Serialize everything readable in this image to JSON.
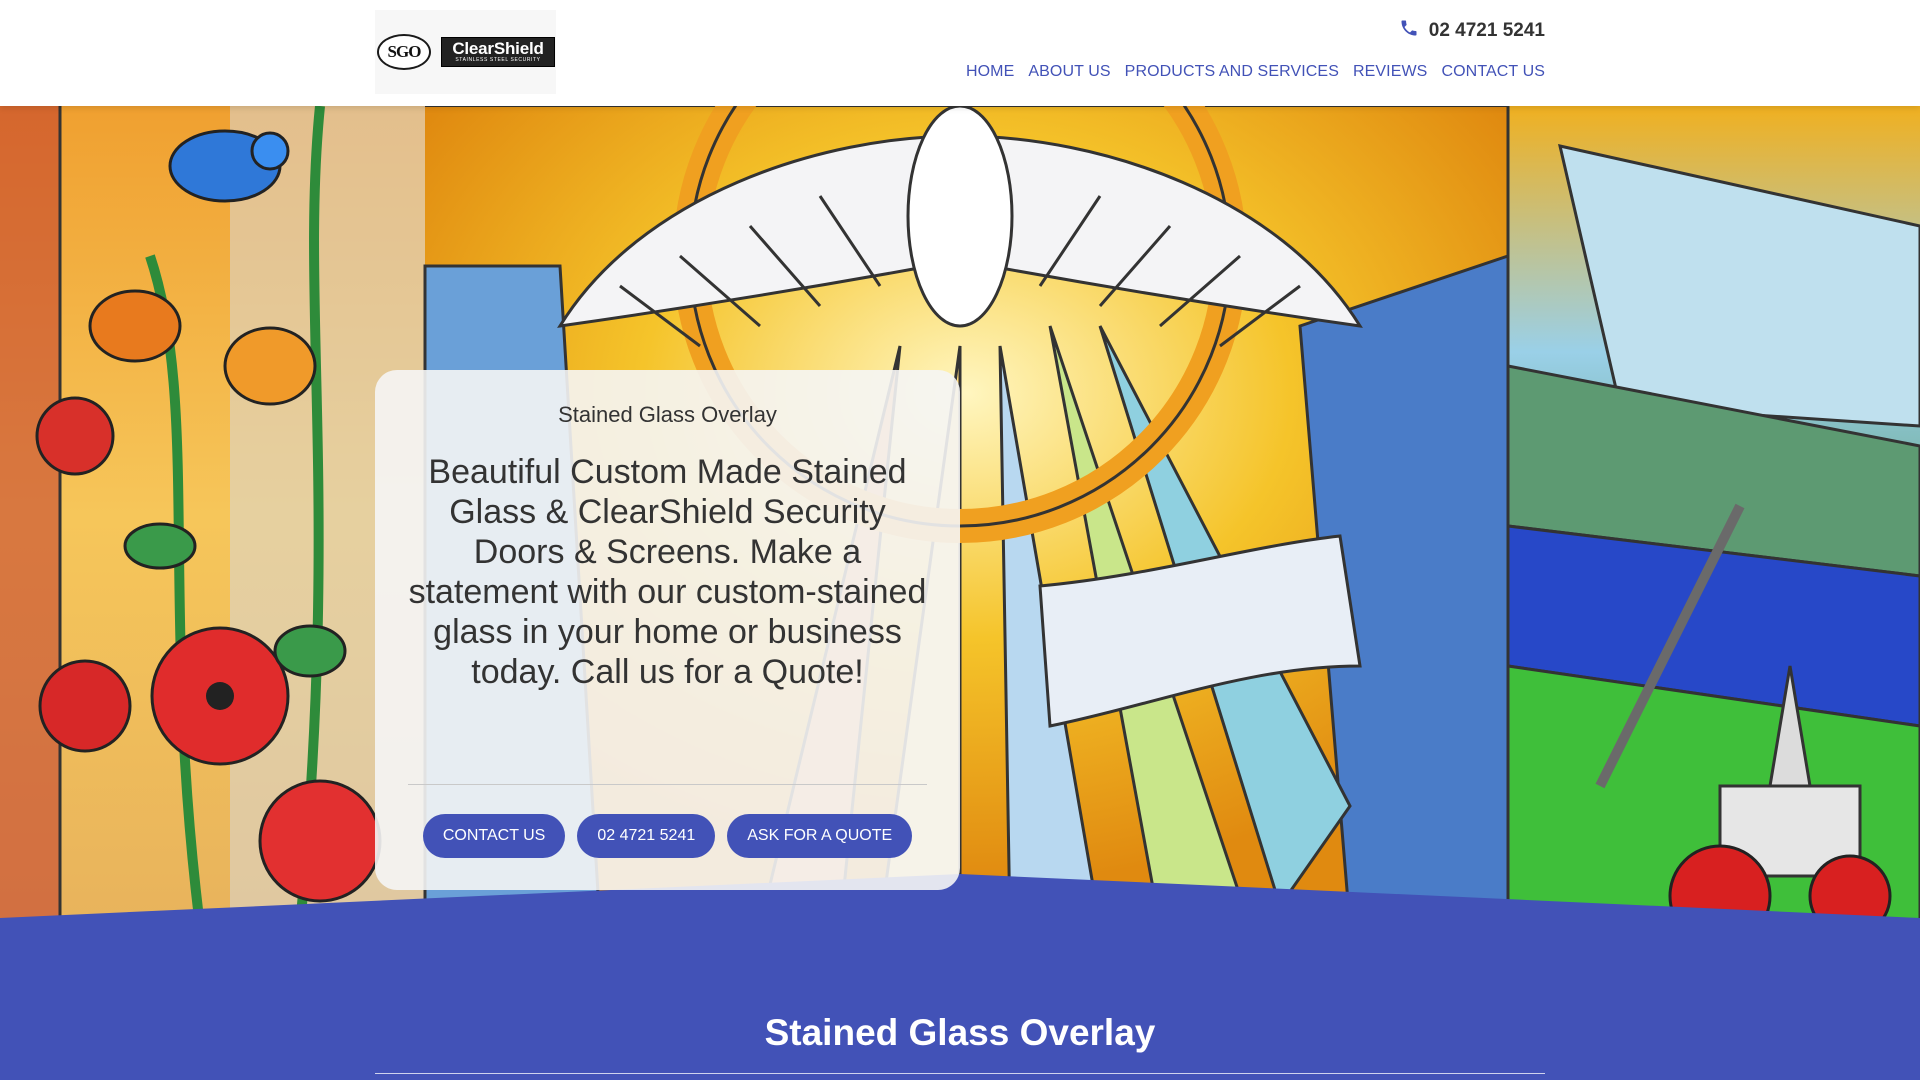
{
  "header": {
    "logo": {
      "sgo_text": "SGO",
      "brand_text": "ClearShield",
      "brand_subtext": "STAINLESS STEEL SECURITY"
    },
    "phone": "02 4721 5241",
    "phone_icon": "phone-icon",
    "nav": [
      {
        "label": "HOME"
      },
      {
        "label": "ABOUT US"
      },
      {
        "label": "PRODUCTS AND SERVICES"
      },
      {
        "label": "REVIEWS"
      },
      {
        "label": "CONTACT US"
      }
    ]
  },
  "hero": {
    "subtitle": "Stained Glass Overlay",
    "title": "Beautiful Custom Made Stained Glass & ClearShield Security Doors & Screens. Make a statement with our custom-stained glass in your home or business today. Call us for a Quote!",
    "buttons": [
      {
        "label": "CONTACT US"
      },
      {
        "label": "02 4721 5241"
      },
      {
        "label": "ASK FOR A QUOTE"
      }
    ]
  },
  "section": {
    "title": "Stained Glass Overlay"
  },
  "colors": {
    "accent": "#4252b7",
    "text": "#333333"
  }
}
